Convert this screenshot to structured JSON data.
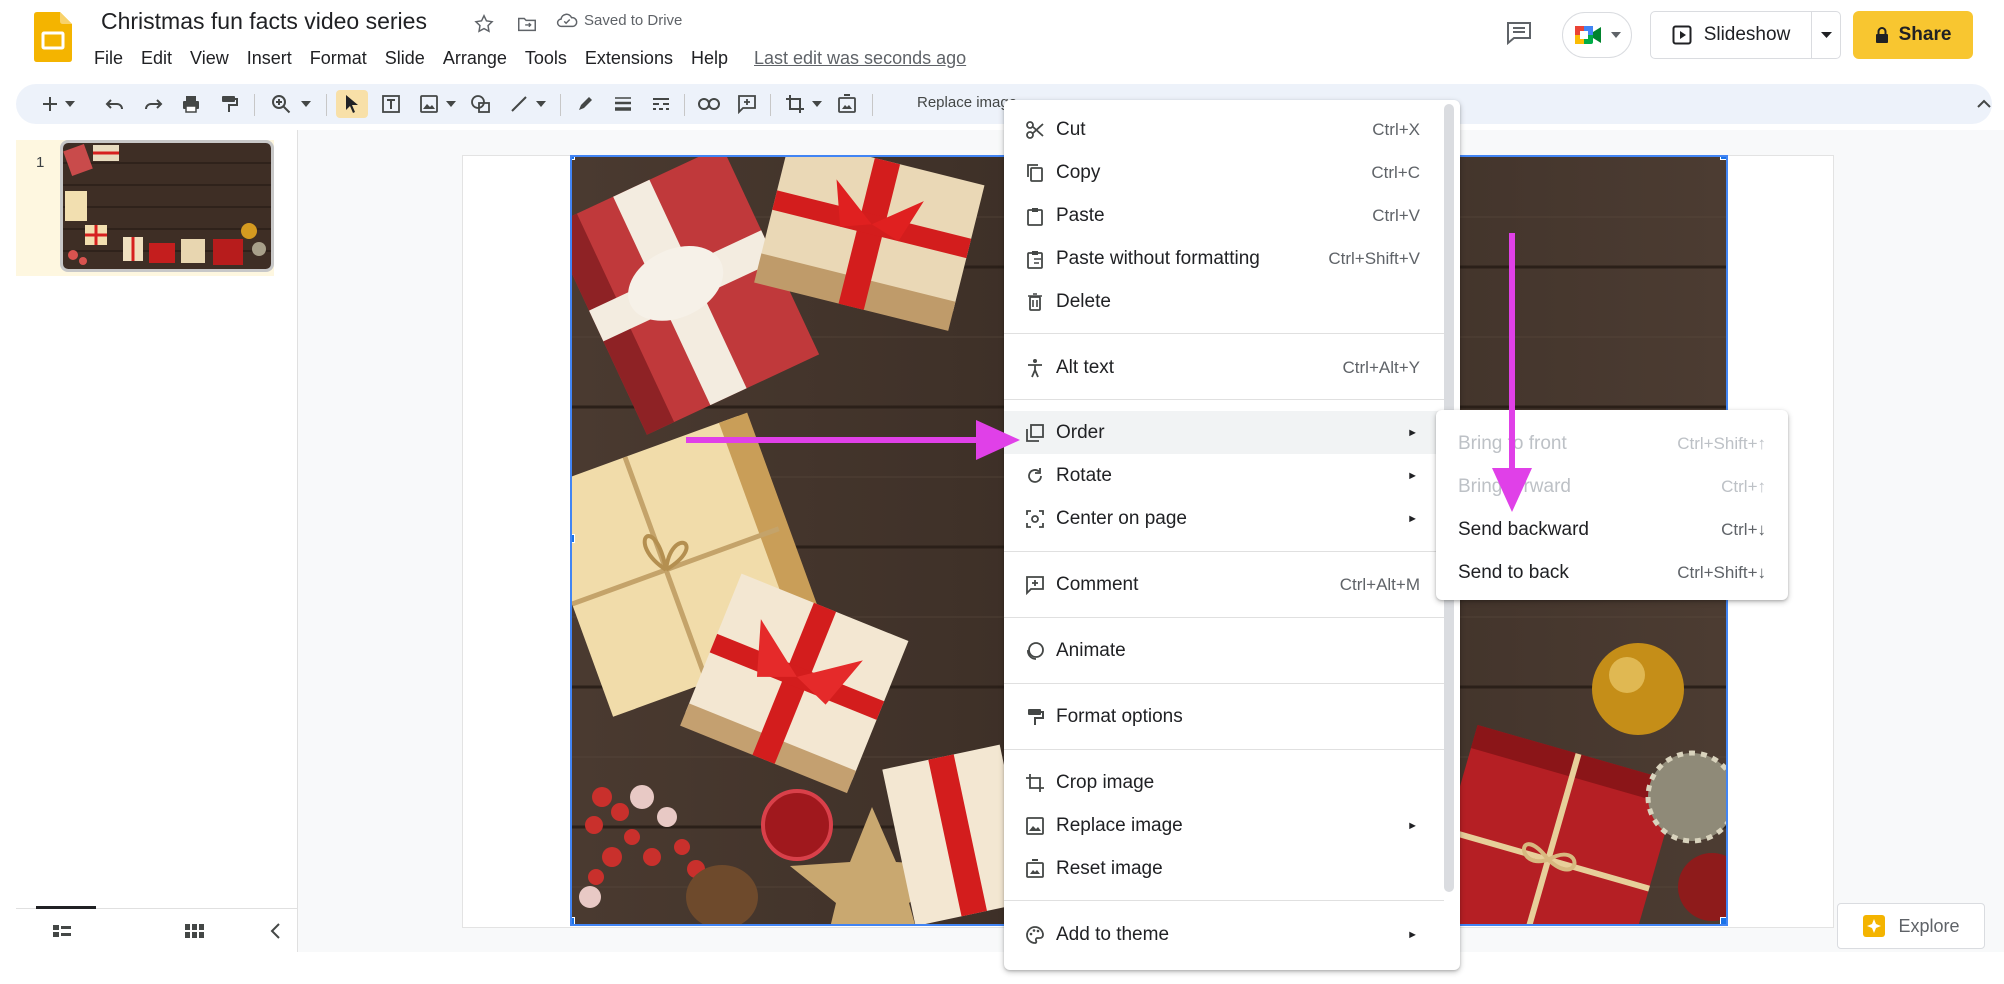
{
  "app": {
    "title": "Christmas fun facts video series",
    "saved_status": "Saved to Drive",
    "last_edit": "Last edit was seconds ago",
    "menus": [
      "File",
      "Edit",
      "View",
      "Insert",
      "Format",
      "Slide",
      "Arrange",
      "Tools",
      "Extensions",
      "Help"
    ],
    "slideshow_label": "Slideshow",
    "share_label": "Share",
    "brand_color": "#f4b400",
    "share_color": "#f8c630"
  },
  "toolbar": {
    "replace_image_label": "Replace image"
  },
  "filmstrip": {
    "slide_number": "1"
  },
  "context_menu": {
    "items": [
      {
        "label": "Cut",
        "shortcut": "Ctrl+X",
        "icon": "scissors-icon"
      },
      {
        "label": "Copy",
        "shortcut": "Ctrl+C",
        "icon": "copy-icon"
      },
      {
        "label": "Paste",
        "shortcut": "Ctrl+V",
        "icon": "paste-icon"
      },
      {
        "label": "Paste without formatting",
        "shortcut": "Ctrl+Shift+V",
        "icon": "paste-plain-icon"
      },
      {
        "label": "Delete",
        "shortcut": "",
        "icon": "trash-icon"
      },
      {
        "label": "Alt text",
        "shortcut": "Ctrl+Alt+Y",
        "icon": "accessibility-icon"
      },
      {
        "label": "Order",
        "shortcut": "",
        "icon": "order-icon",
        "submenu": true,
        "highlighted": true
      },
      {
        "label": "Rotate",
        "shortcut": "",
        "icon": "rotate-icon",
        "submenu": true
      },
      {
        "label": "Center on page",
        "shortcut": "",
        "icon": "center-icon",
        "submenu": true
      },
      {
        "label": "Comment",
        "shortcut": "Ctrl+Alt+M",
        "icon": "comment-add-icon"
      },
      {
        "label": "Animate",
        "shortcut": "",
        "icon": "animate-icon"
      },
      {
        "label": "Format options",
        "shortcut": "",
        "icon": "format-paint-icon"
      },
      {
        "label": "Crop image",
        "shortcut": "",
        "icon": "crop-icon"
      },
      {
        "label": "Replace image",
        "shortcut": "",
        "icon": "image-icon",
        "submenu": true
      },
      {
        "label": "Reset image",
        "shortcut": "",
        "icon": "reset-image-icon"
      },
      {
        "label": "Add to theme",
        "shortcut": "",
        "icon": "palette-icon",
        "submenu": true
      }
    ]
  },
  "order_submenu": {
    "items": [
      {
        "label": "Bring to front",
        "shortcut": "Ctrl+Shift+↑",
        "enabled": false
      },
      {
        "label": "Bring forward",
        "shortcut": "Ctrl+↑",
        "enabled": false
      },
      {
        "label": "Send backward",
        "shortcut": "Ctrl+↓",
        "enabled": true
      },
      {
        "label": "Send to back",
        "shortcut": "Ctrl+Shift+↓",
        "enabled": true
      }
    ]
  },
  "explore": {
    "label": "Explore"
  },
  "annotation": {
    "arrow_color": "#e040e8"
  }
}
